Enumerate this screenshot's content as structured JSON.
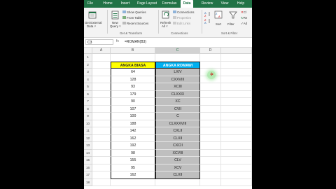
{
  "ribbon": {
    "tabs": [
      "File",
      "Home",
      "Insert",
      "Page Layout",
      "Formulas",
      "Data",
      "Review",
      "View",
      "Help"
    ],
    "active_tab": "Data",
    "get_external_label": "Get External",
    "get_external_label2": "Data ˅",
    "new_query_label": "New",
    "new_query_label2": "Query ˅",
    "show_queries": "Show Queries",
    "from_table": "From Table",
    "recent_sources": "Recent Sources",
    "get_transform_label": "Get & Transform",
    "refresh_label": "Refresh",
    "refresh_label2": "All ˅",
    "connections_item": "Connections",
    "properties_item": "Properties",
    "edit_links_item": "Edit Links",
    "connections_group_label": "Connections",
    "sort_label": "Sort",
    "filter_label": "Filter",
    "sort_filter_label": "Sort & Filter",
    "clear_label": "Cl",
    "reapply_label": "Re",
    "advanced_label": "Ad"
  },
  "formula_bar": {
    "name_box": "C3",
    "fx_label": "fx",
    "formula": "=ROMAN(B3)"
  },
  "columns": [
    "A",
    "B",
    "C",
    "D"
  ],
  "rows": [
    "1",
    "2",
    "3",
    "4",
    "5",
    "6",
    "7",
    "8",
    "9",
    "10",
    "11",
    "12",
    "13",
    "14",
    "15",
    "16",
    "17",
    "18"
  ],
  "table": {
    "header_a": "ANGKA BIASA",
    "header_b": "ANGKA ROMAWI",
    "values": [
      "64",
      "128",
      "93",
      "179",
      "90",
      "107",
      "100",
      "188",
      "142",
      "162",
      "192",
      "98",
      "155",
      "95",
      "162"
    ],
    "romans": [
      "LXIV",
      "CXXVIII",
      "XCIII",
      "CLXXIX",
      "XC",
      "CVII",
      "C",
      "CLXXXVIII",
      "CXLII",
      "CLXII",
      "CXCII",
      "XCVIII",
      "CLV",
      "XCV",
      "CLXII"
    ]
  },
  "colors": {
    "accent": "#217346",
    "yellow": "#ffff00",
    "blue": "#00b0f0",
    "gray": "#bfbfbf"
  }
}
